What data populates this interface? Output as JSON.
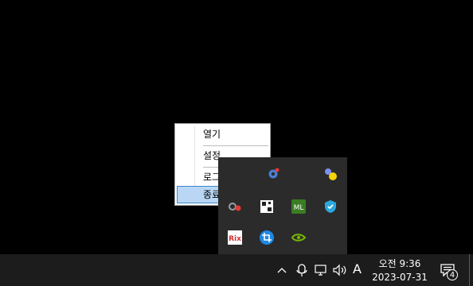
{
  "context_menu": {
    "items": [
      {
        "label": "열기"
      },
      {
        "label": "설정"
      },
      {
        "label": "로그아웃"
      },
      {
        "label": "종료"
      }
    ],
    "highlight_color": "#b9d7f5"
  },
  "tray_overflow": {
    "icons": [
      {
        "name": "settings-gear-icon"
      },
      {
        "name": "dots-yellow-icon"
      },
      {
        "name": "google-icon"
      },
      {
        "name": "qr-icon"
      },
      {
        "name": "ml-icon"
      },
      {
        "name": "shield-icon"
      },
      {
        "name": "rix-icon",
        "text": "Rix"
      },
      {
        "name": "crop-icon"
      },
      {
        "name": "nvidia-icon"
      }
    ]
  },
  "taskbar": {
    "ime_mode": "A",
    "clock": {
      "time": "오전 9:36",
      "date": "2023-07-31"
    },
    "notification_count": "4"
  }
}
